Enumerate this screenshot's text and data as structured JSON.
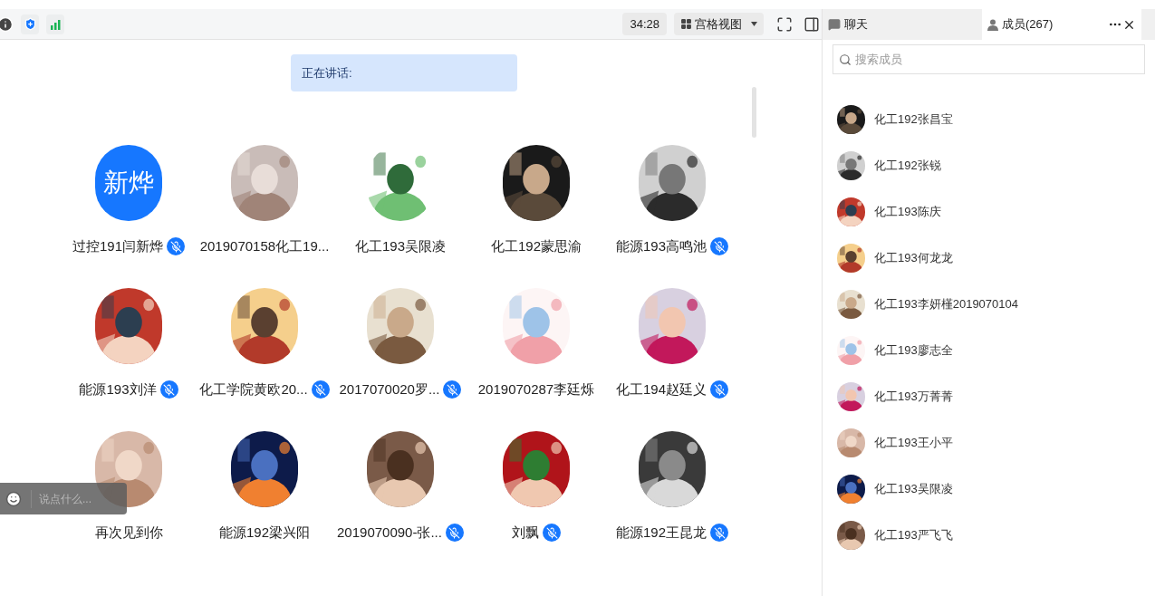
{
  "toolbar": {
    "timer": "34:28",
    "view_mode": "宫格视图"
  },
  "speaking_banner": "正在讲话:",
  "tiles": [
    {
      "name": "过控191闫新烨",
      "avatar": {
        "kind": "text",
        "text": "新烨"
      },
      "muted": true
    },
    {
      "name": "2019070158化工19...",
      "muted": false
    },
    {
      "name": "化工193吴限凌",
      "muted": false
    },
    {
      "name": "化工192蒙思渝",
      "muted": false
    },
    {
      "name": "能源193高鸣池",
      "muted": true
    },
    {
      "name": "能源193刘洋",
      "muted": true
    },
    {
      "name": "化工学院黄欧20...",
      "muted": true
    },
    {
      "name": "2017070020罗...",
      "muted": true
    },
    {
      "name": "2019070287李廷烁",
      "muted": false
    },
    {
      "name": "化工194赵廷义",
      "muted": true
    },
    {
      "name": "再次见到你",
      "muted": false
    },
    {
      "name": "能源192梁兴阳",
      "muted": false
    },
    {
      "name": "2019070090-张...",
      "muted": true
    },
    {
      "name": "刘飘",
      "muted": true
    },
    {
      "name": "能源192王昆龙",
      "muted": true
    }
  ],
  "chat_input": {
    "placeholder": "说点什么..."
  },
  "side_tabs": [
    {
      "label": "聊天",
      "selected": false
    },
    {
      "label": "成员(267)",
      "selected": true
    }
  ],
  "member_search": {
    "placeholder": "搜索成员"
  },
  "members": [
    "化工192张昌宝",
    "化工192张锐",
    "化工193陈庆",
    "化工193何龙龙",
    "化工193李妍槿2019070104",
    "化工193廖志全",
    "化工193万菁菁",
    "化工193王小平",
    "化工193吴限凌",
    "化工193严飞飞"
  ]
}
